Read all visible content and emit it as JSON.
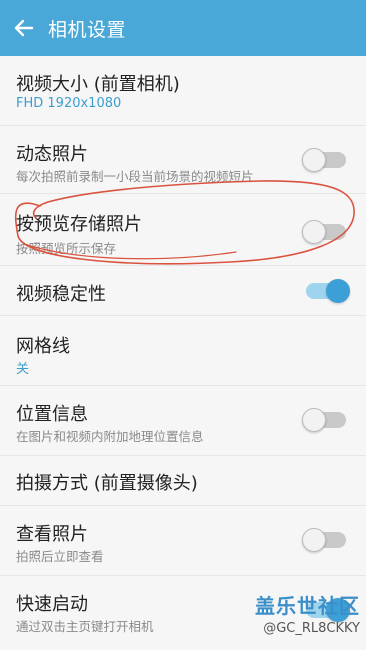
{
  "header": {
    "title": "相机设置"
  },
  "settings": [
    {
      "label": "视频大小 (前置相机)",
      "sub": "FHD 1920x1080"
    },
    {
      "label": "动态照片",
      "sub": "每次拍照前录制一小段当前场景的视频短片",
      "toggle": false
    },
    {
      "label": "按预览存储照片",
      "sub": "按照预览所示保存",
      "toggle": false
    },
    {
      "label": "视频稳定性",
      "toggle": true
    },
    {
      "label": "网格线",
      "sub": "关"
    },
    {
      "label": "位置信息",
      "sub": "在图片和视频内附加地理位置信息",
      "toggle": false
    },
    {
      "label": "拍摄方式 (前置摄像头)"
    },
    {
      "label": "查看照片",
      "sub": "拍照后立即查看",
      "toggle": false
    },
    {
      "label": "快速启动",
      "sub": "通过双击主页键打开相机"
    }
  ],
  "watermark": {
    "logo": "盖乐世社区",
    "user": "@GC_RL8CKKY"
  },
  "colors": {
    "appbar": "#4aa8d8",
    "accent": "#3c9fd6",
    "annotation": "#d9533e"
  }
}
